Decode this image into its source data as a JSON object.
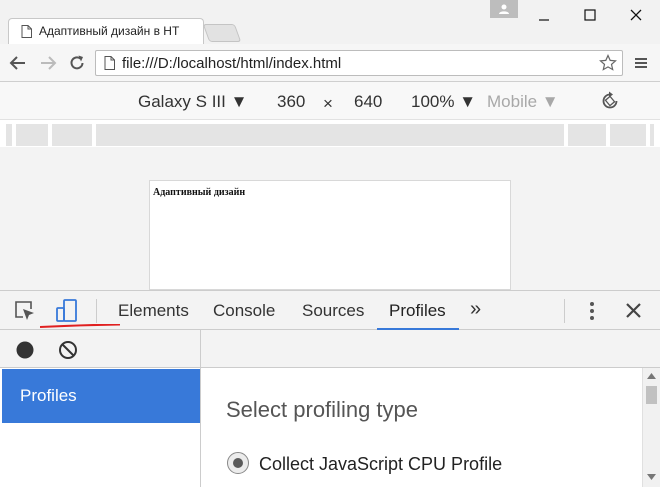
{
  "browser": {
    "tab_title": "Адаптивный дизайн в HT",
    "url": "file:///D:/localhost/html/index.html"
  },
  "device_toolbar": {
    "device": "Galaxy S III ▼",
    "width": "360",
    "times": "×",
    "height": "640",
    "zoom": "100% ▼",
    "mode": "Mobile ▼"
  },
  "page": {
    "text": "Адаптивный дизайн"
  },
  "devtools": {
    "tabs": [
      "Elements",
      "Console",
      "Sources",
      "Profiles"
    ],
    "more": "»",
    "sidebar_item": "Profiles",
    "heading": "Select profiling type",
    "option": "Collect JavaScript CPU Profile"
  },
  "colors": {
    "accent": "#3879d9",
    "annotation": "#e02020"
  }
}
